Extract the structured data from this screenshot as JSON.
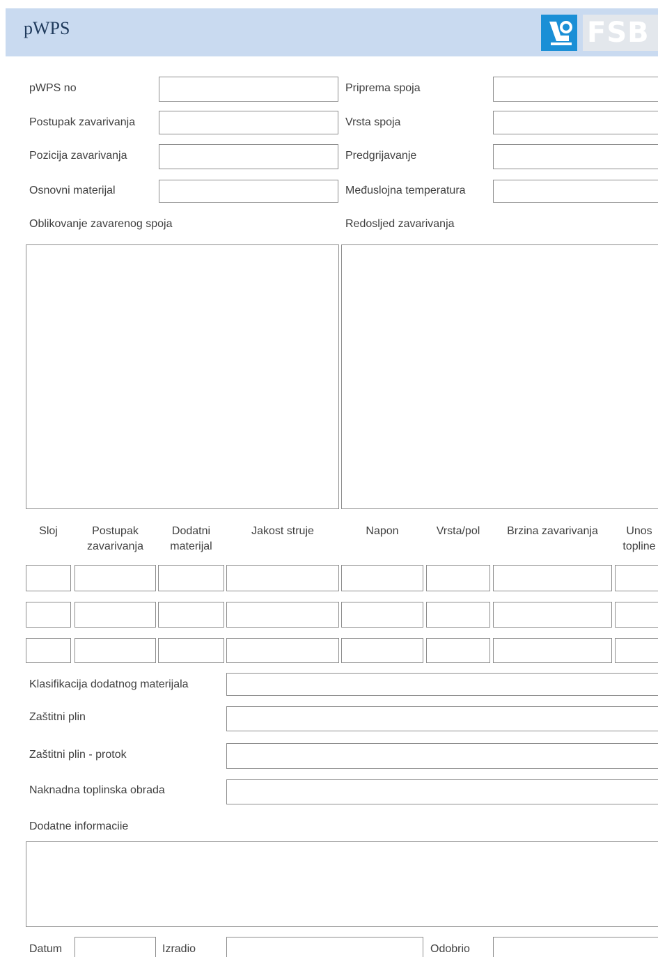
{
  "header": {
    "title": "pWPS",
    "logo_text": "FSB"
  },
  "fields": {
    "pwps_no": "pWPS no",
    "postupak": "Postupak zavarivanja",
    "pozicija": "Pozicija zavarivanja",
    "osnovni": "Osnovni materijal",
    "priprema": "Priprema spoja",
    "vrsta_spoja": "Vrsta spoja",
    "predgrijavanje": "Predgrijavanje",
    "meduslojna": "Međuslojna temperatura",
    "oblikovanje": "Oblikovanje zavarenog spoja",
    "redoslijed": "Redosljed zavarivanja"
  },
  "table": {
    "headers": [
      [
        "Sloj"
      ],
      [
        "Postupak",
        "zavarivanja"
      ],
      [
        "Dodatni",
        "materijal"
      ],
      [
        "Jakost struje"
      ],
      [
        "Napon"
      ],
      [
        "Vrsta/pol"
      ],
      [
        "Brzina zavarivanja"
      ],
      [
        "Unos",
        "topline"
      ]
    ]
  },
  "lower": {
    "klasifikacija": "Klasifikacija dodatnog materijala",
    "zastitni_plin": "Zaštitni plin",
    "zastitni_plin_protok": "Zaštitni plin - protok",
    "naknadna": "Naknadna toplinska obrada",
    "dodatne": "Dodatne informaciie"
  },
  "footer": {
    "datum": "Datum",
    "izradio": "Izradio",
    "odobrio": "Odobrio"
  }
}
